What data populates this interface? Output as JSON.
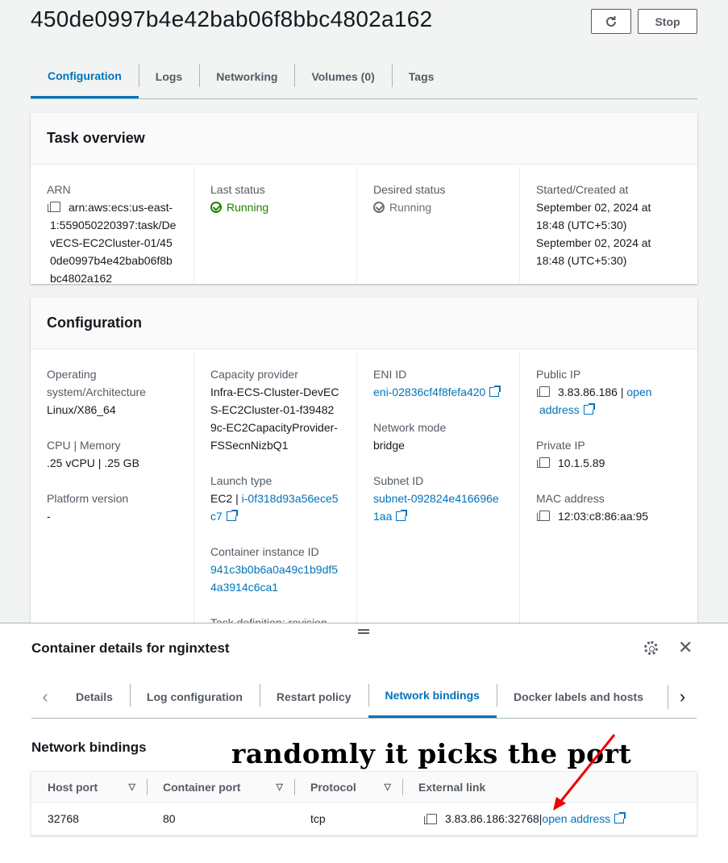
{
  "header": {
    "task_id": "450de0997b4e42bab06f8bbc4802a162",
    "stop_label": "Stop"
  },
  "tabs": [
    "Configuration",
    "Logs",
    "Networking",
    "Volumes (0)",
    "Tags"
  ],
  "task_overview": {
    "title": "Task overview",
    "arn_label": "ARN",
    "arn_value": "arn:aws:ecs:us-east-1:559050220397:task/DevECS-EC2Cluster-01/450de0997b4e42bab06f8bbc4802a162",
    "last_status_label": "Last status",
    "last_status_value": "Running",
    "desired_status_label": "Desired status",
    "desired_status_value": "Running",
    "started_label": "Started/Created at",
    "started_value": "September 02, 2024 at 18:48 (UTC+5:30)",
    "created_value": "September 02, 2024 at 18:48 (UTC+5:30)"
  },
  "configuration": {
    "title": "Configuration",
    "os_label": "Operating system/Architecture",
    "os_value": "Linux/X86_64",
    "cpu_label": "CPU | Memory",
    "cpu_value": ".25 vCPU | .25 GB",
    "platform_label": "Platform version",
    "platform_value": "-",
    "capacity_label": "Capacity provider",
    "capacity_value": "Infra-ECS-Cluster-DevECS-EC2Cluster-01-f394829c-EC2CapacityProvider-FSSecnNizbQ1",
    "launch_label": "Launch type",
    "launch_prefix": "EC2 | ",
    "launch_link": "i-0f318d93a56ece5c7",
    "container_instance_label": "Container instance ID",
    "container_instance_value": "941c3b0b6a0a49c1b9df54a3914c6ca1",
    "task_def_label": "Task definition: revision",
    "eni_label": "ENI ID",
    "eni_value": "eni-02836cf4f8fefa420",
    "network_mode_label": "Network mode",
    "network_mode_value": "bridge",
    "subnet_label": "Subnet ID",
    "subnet_value": "subnet-092824e416696e1aa",
    "public_ip_label": "Public IP",
    "public_ip_value": "3.83.86.186",
    "public_ip_sep": " | ",
    "open_address": "open address",
    "private_ip_label": "Private IP",
    "private_ip_value": "10.1.5.89",
    "mac_label": "MAC address",
    "mac_value": "12:03:c8:86:aa:95"
  },
  "container_details": {
    "title": "Container details for nginxtest",
    "tabs": [
      "Details",
      "Log configuration",
      "Restart policy",
      "Network bindings",
      "Docker labels and hosts"
    ],
    "section_title": "Network bindings",
    "annotation": "randomly it picks the port number",
    "columns": [
      "Host port",
      "Container port",
      "Protocol",
      "External link"
    ],
    "rows": [
      {
        "host_port": "32768",
        "container_port": "80",
        "protocol": "tcp",
        "external": "3.83.86.186:32768",
        "sep": " | ",
        "link": "open address"
      }
    ]
  }
}
